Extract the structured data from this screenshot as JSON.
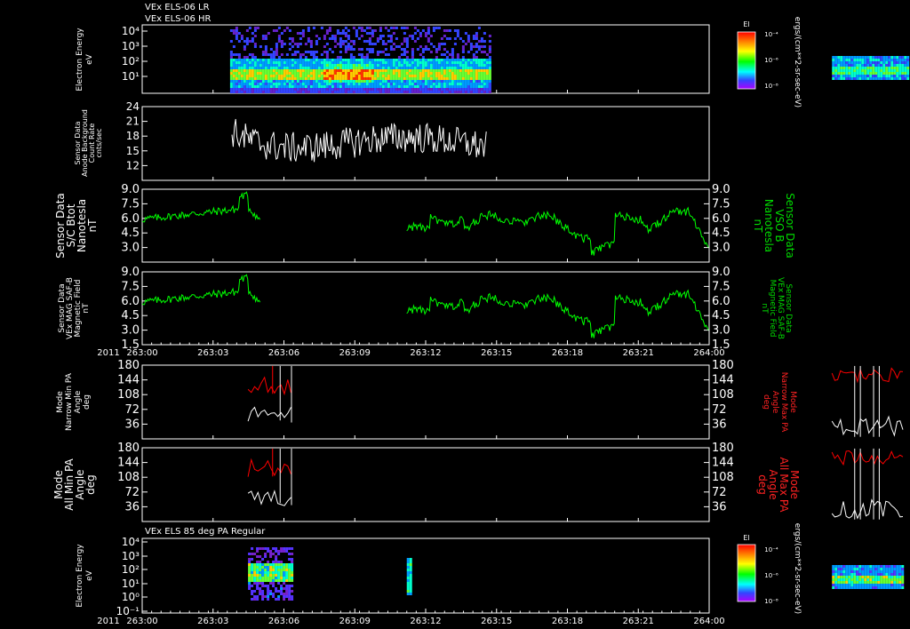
{
  "chart_data": {
    "type": "line",
    "header": {
      "line1": "VEx ELS-06 LR",
      "line2": "VEx ELS-06 HR"
    },
    "time_axis": {
      "year": "2011",
      "ticks": [
        "263:00",
        "263:03",
        "263:06",
        "263:09",
        "263:12",
        "263:15",
        "263:18",
        "263:21",
        "264:00"
      ],
      "range_minutes": [
        0,
        60
      ]
    },
    "panels": [
      {
        "id": "spectrogram_top",
        "type": "heatmap",
        "ylabel_lines": [
          "Electron Energy",
          "eV"
        ],
        "yticks": [
          "10⁴",
          "10³",
          "10²",
          "10¹"
        ],
        "colorbar": {
          "title": "El",
          "ticks": [
            "10⁻⁴",
            "10⁻⁶",
            "10⁻⁸"
          ],
          "units": "ergs/(cm**2-sr-sec-eV)"
        },
        "blocks": [
          {
            "t_start": 9.3,
            "t_end": 36.8
          },
          {
            "t_start": 73.0,
            "t_end": 81.0
          }
        ]
      },
      {
        "id": "background",
        "type": "line",
        "ylabel_lines": [
          "Sensor Data",
          "Anode Background",
          "Count Rate",
          "cnts/sec"
        ],
        "yticks": [
          "24",
          "21",
          "18",
          "15",
          "12"
        ],
        "ylim": [
          9,
          24
        ],
        "series": [
          {
            "color": "#ffffff",
            "t_range": [
              9.5,
              36.5
            ],
            "mean": 16.5,
            "amp": 3.2
          }
        ]
      },
      {
        "id": "mag_btot_vso",
        "type": "line",
        "left_label_lines": [
          "Sensor Data",
          "S/C Btot",
          "Nanotesla",
          "nT"
        ],
        "right_label_lines": [
          "Sensor Data",
          "VSO B",
          "Nanotesla",
          "nT"
        ],
        "yticks": [
          "9.0",
          "7.5",
          "6.0",
          "4.5",
          "3.0"
        ],
        "ylim": [
          1.5,
          9.0
        ],
        "series": [
          {
            "color": "#00ff00",
            "segments": [
              [
                0,
                12.5
              ],
              [
                28,
                60
              ]
            ]
          }
        ]
      },
      {
        "id": "mag_field",
        "type": "line",
        "left_label_lines": [
          "Sensor Data",
          "VEx MAG SAF-B",
          "Magnetic Field",
          "nT"
        ],
        "right_label_lines": [
          "Sensor Data",
          "VEx MAG SAF-B",
          "Magnetic Field",
          "nT"
        ],
        "yticks": [
          "9.0",
          "7.5",
          "6.0",
          "4.5",
          "3.0",
          "1.5"
        ],
        "ylim": [
          1.5,
          9.0
        ],
        "series": [
          {
            "color": "#00ff00",
            "segments": [
              [
                0,
                12.5
              ],
              [
                28,
                60
              ]
            ]
          }
        ]
      },
      {
        "id": "pa_narrow",
        "type": "line",
        "left_label_lines": [
          "Mode",
          "Narrow Min PA",
          "Angle",
          "deg"
        ],
        "right_label_lines": [
          "Mode",
          "Narrow Max PA",
          "Angle",
          "deg"
        ],
        "yticks": [
          "180",
          "144",
          "108",
          "72",
          "36"
        ],
        "ylim": [
          0,
          180
        ],
        "series": [
          {
            "color": "#ff0000",
            "role": "max"
          },
          {
            "color": "#ffffff",
            "role": "min"
          }
        ]
      },
      {
        "id": "pa_all",
        "type": "line",
        "left_label_lines": [
          "Mode",
          "All Min PA",
          "Angle",
          "deg"
        ],
        "right_label_lines": [
          "Mode",
          "All Max PA",
          "Angle",
          "deg"
        ],
        "yticks": [
          "180",
          "144",
          "108",
          "72",
          "36"
        ],
        "ylim": [
          0,
          180
        ],
        "series": [
          {
            "color": "#ff0000",
            "role": "max"
          },
          {
            "color": "#ffffff",
            "role": "min"
          }
        ]
      },
      {
        "id": "spectrogram_bottom",
        "type": "heatmap",
        "title": "VEx ELS 85 deg PA Regular",
        "ylabel_lines": [
          "Electron Energy",
          "eV"
        ],
        "yticks": [
          "10⁴",
          "10³",
          "10²",
          "10¹",
          "10⁰",
          "10⁻¹"
        ],
        "colorbar": {
          "title": "El",
          "ticks": [
            "10⁻⁴",
            "10⁻⁶",
            "10⁻⁸"
          ],
          "units": "ergs/(cm**2-sr-sec-eV)"
        }
      }
    ]
  }
}
